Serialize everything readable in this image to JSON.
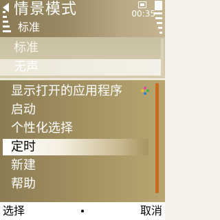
{
  "header": {
    "title": "情景模式",
    "subtitle": "标准",
    "clock": "00:35",
    "icons": [
      "back-arrow-icon",
      "signal-icon",
      "battery-icon",
      "phone-status-icon"
    ]
  },
  "background_list": {
    "items": [
      {
        "label": "标准"
      },
      {
        "label": "无声"
      }
    ]
  },
  "menu": {
    "items": [
      {
        "label": "显示打开的应用程序",
        "icon": "apps-icon"
      },
      {
        "label": "启动"
      },
      {
        "label": "个性化选择"
      },
      {
        "label": "定时",
        "selected": true
      },
      {
        "label": "新建"
      },
      {
        "label": "帮助"
      }
    ]
  },
  "softkeys": {
    "left": "选择",
    "right": "取消"
  },
  "colors": {
    "highlight": "#ffffff",
    "scrollbar": "#c96a1e",
    "menu_bg": "#a39161"
  }
}
